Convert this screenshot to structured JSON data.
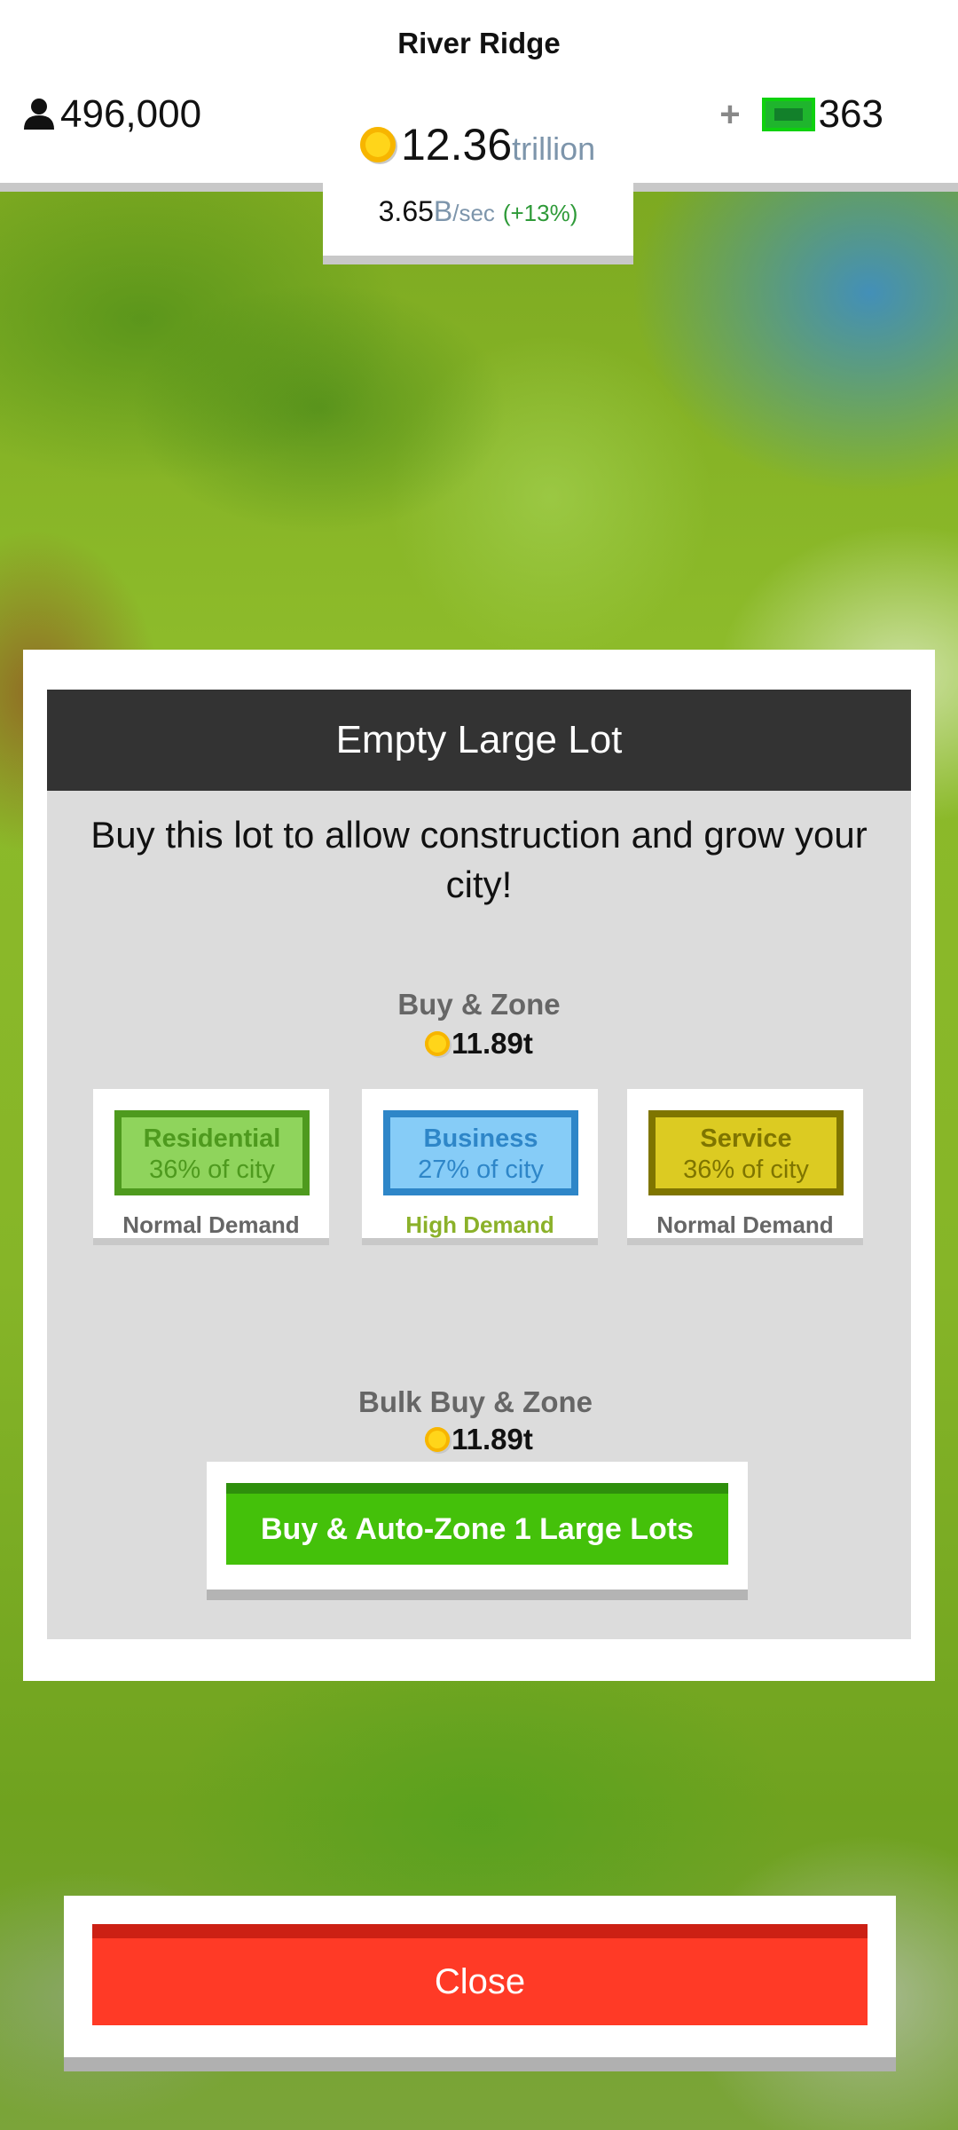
{
  "header": {
    "city_name": "River Ridge",
    "population": "496,000",
    "gems": "363",
    "gems_plus": "+",
    "money_value": "12.36",
    "money_unit": "trillion",
    "income_value": "3.65",
    "income_unit": "B",
    "income_rate": "/sec",
    "income_change": "(+13%)"
  },
  "modal": {
    "title": "Empty Large Lot",
    "description": "Buy this lot to allow construction and grow your city!",
    "zone_section_title": "Buy & Zone",
    "zone_cost": "11.89t",
    "zones": [
      {
        "name": "Residential",
        "share": "36% of city",
        "demand": "Normal Demand",
        "color": "#8fd45c"
      },
      {
        "name": "Business",
        "share": "27% of city",
        "demand": "High Demand",
        "color": "#86ccf7"
      },
      {
        "name": "Service",
        "share": "36% of city",
        "demand": "Normal Demand",
        "color": "#dccb22"
      }
    ],
    "bulk_section_title": "Bulk Buy & Zone",
    "bulk_cost": "11.89t",
    "bulk_button_label": "Buy & Auto-Zone 1 Large Lots"
  },
  "close_button_label": "Close",
  "colors": {
    "header_bar": "#333333",
    "bulk_button": "#44c10a",
    "close_button": "#ff3a26",
    "high_demand": "#8bb12a"
  },
  "icons": {
    "population": "person-icon",
    "gems": "green-cash-icon",
    "money": "coin-icon"
  }
}
